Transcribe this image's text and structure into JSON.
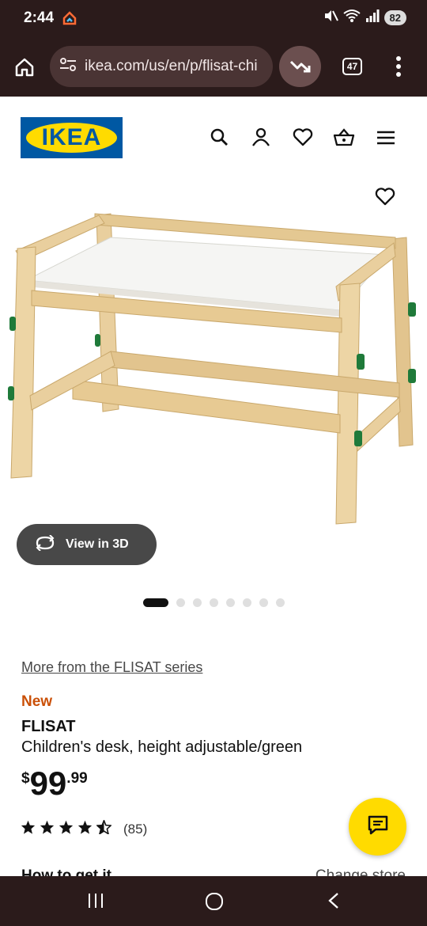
{
  "status_bar": {
    "time": "2:44",
    "battery": "82",
    "icons": [
      "google-home-icon",
      "mute-icon",
      "wifi-icon",
      "signal-icon"
    ]
  },
  "browser": {
    "url": "ikea.com/us/en/p/flisat-chi",
    "tab_count": "47",
    "icons": [
      "home-icon",
      "site-settings-icon",
      "trending-down-icon",
      "more-vert-icon"
    ]
  },
  "header": {
    "logo_text": "IKEA",
    "icons": [
      "search-icon",
      "account-icon",
      "heart-icon",
      "basket-icon",
      "hamburger-icon"
    ]
  },
  "gallery": {
    "view_3d_label": "View in 3D",
    "slide_count": 8,
    "active_slide": 1
  },
  "product": {
    "series_link": "More from the FLISAT series",
    "badge": "New",
    "name": "FLISAT",
    "description": "Children's desk, height adjustable/green",
    "price_currency": "$",
    "price_integer": "99",
    "price_decimal": ".99",
    "rating_stars": 4.5,
    "rating_count": "(85)"
  },
  "below_fold": {
    "left": "How to get it",
    "right": "Change store"
  },
  "colors": {
    "ikea_blue": "#0058a3",
    "ikea_yellow": "#ffdb00",
    "new_badge": "#ca5008",
    "browser_chrome": "#2b1b1b"
  }
}
